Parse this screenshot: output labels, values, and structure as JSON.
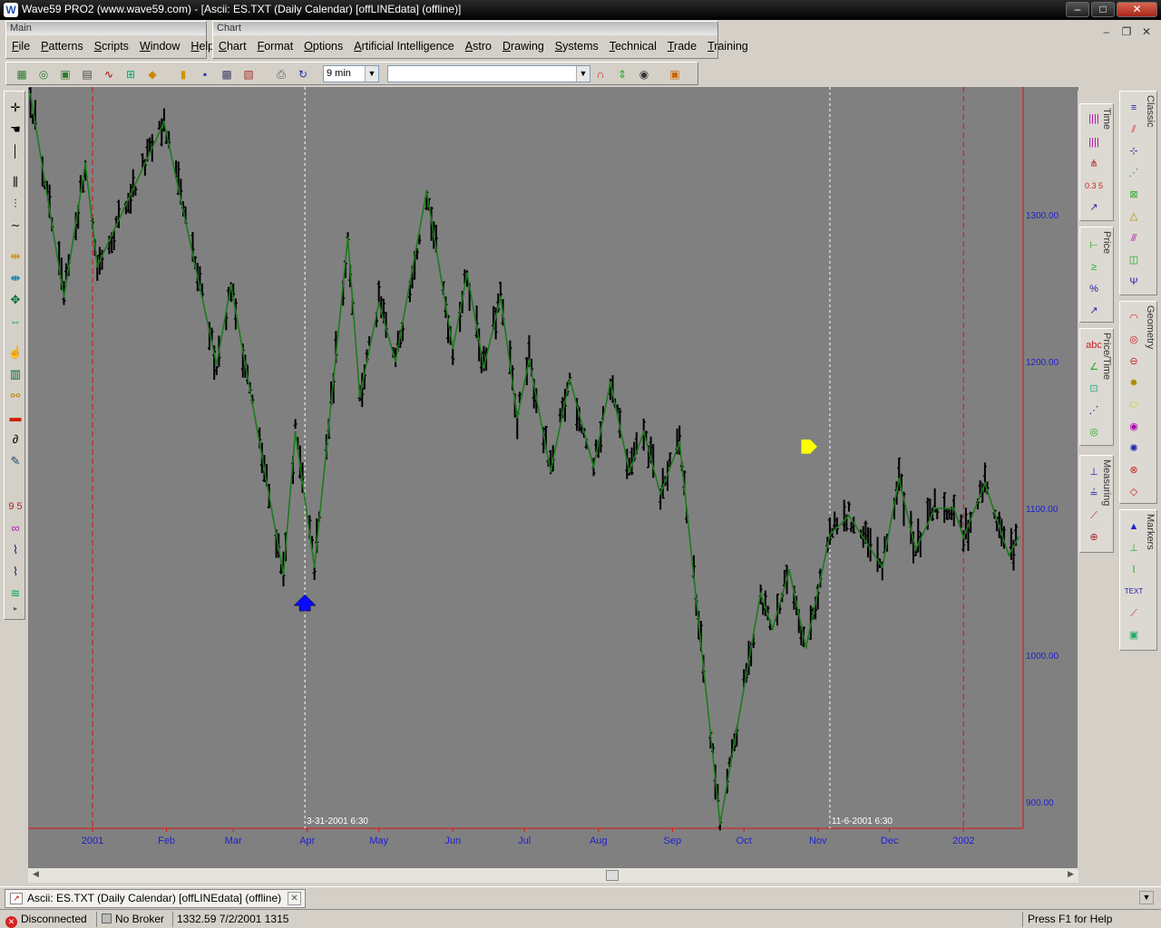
{
  "window": {
    "title": "Wave59 PRO2 (www.wave59.com) - [Ascii: ES.TXT (Daily Calendar) [offLINEdata] (offline)]",
    "minimize": "–",
    "maximize": "□",
    "close": "✕"
  },
  "mdi": {
    "minimize": "–",
    "restore": "❐",
    "close": "✕"
  },
  "bands": {
    "main": {
      "label": "Main",
      "menu": [
        "File",
        "Patterns",
        "Scripts",
        "Window",
        "Help"
      ]
    },
    "chart": {
      "label": "Chart",
      "menu": [
        "Chart",
        "Format",
        "Options",
        "Artificial Intelligence",
        "Astro",
        "Drawing",
        "Systems",
        "Technical",
        "Trade",
        "Training"
      ]
    }
  },
  "toolbar": {
    "interval_value": "9 min",
    "symbol_value": ""
  },
  "right_sections": {
    "time": "Time",
    "price": "Price",
    "price_time": "Price/Time",
    "measuring": "Measuring",
    "classic": "Classic",
    "geometry": "Geometry",
    "markers": "Markers",
    "fib_label": "0.3 5",
    "abc_label": "abc",
    "percent_label": "%",
    "text_label": "TEXT"
  },
  "left_tool_labels": {
    "ninefive": "9 5"
  },
  "chart_data": {
    "type": "line",
    "x_tick_labels": [
      "2001",
      "Feb",
      "Mar",
      "Apr",
      "May",
      "Jun",
      "Jul",
      "Aug",
      "Sep",
      "Oct",
      "Nov",
      "Dec",
      "2002"
    ],
    "x_tick_dates": [
      "2001-01-01",
      "2001-02-01",
      "2001-03-01",
      "2001-04-01",
      "2001-05-01",
      "2001-06-01",
      "2001-07-01",
      "2001-08-01",
      "2001-09-01",
      "2001-10-01",
      "2001-11-01",
      "2001-12-01",
      "2002-01-01"
    ],
    "x_range": [
      "2000-12-05",
      "2002-01-26"
    ],
    "y_tick_labels": [
      "900.00",
      "1000.00",
      "1100.00",
      "1200.00",
      "1300.00"
    ],
    "y_ticks": [
      900,
      1000,
      1100,
      1200,
      1300
    ],
    "ylim": [
      882,
      1387
    ],
    "grid": false,
    "cursor_lines": [
      {
        "date": "2001-03-31",
        "label": "3-31-2001 6:30"
      },
      {
        "date": "2001-11-06",
        "label": "11-6-2001 6:30"
      }
    ],
    "year_lines": [
      "2001-01-01",
      "2002-01-01"
    ],
    "series": [
      {
        "style": "zigzag",
        "color": "#1c7a1c",
        "points": [
          [
            "2000-12-06",
            1382
          ],
          [
            "2000-12-20",
            1244
          ],
          [
            "2000-12-29",
            1335
          ],
          [
            "2001-01-03",
            1265
          ],
          [
            "2001-01-31",
            1363
          ],
          [
            "2001-02-22",
            1198
          ],
          [
            "2001-02-28",
            1252
          ],
          [
            "2001-03-22",
            1055
          ],
          [
            "2001-03-27",
            1152
          ],
          [
            "2001-04-04",
            1060
          ],
          [
            "2001-04-18",
            1284
          ],
          [
            "2001-04-23",
            1176
          ],
          [
            "2001-05-01",
            1240
          ],
          [
            "2001-05-08",
            1200
          ],
          [
            "2001-05-21",
            1316
          ],
          [
            "2001-06-01",
            1209
          ],
          [
            "2001-06-07",
            1260
          ],
          [
            "2001-06-14",
            1196
          ],
          [
            "2001-06-21",
            1244
          ],
          [
            "2001-06-28",
            1162
          ],
          [
            "2001-07-03",
            1201
          ],
          [
            "2001-07-12",
            1125
          ],
          [
            "2001-07-20",
            1188
          ],
          [
            "2001-07-30",
            1128
          ],
          [
            "2001-08-06",
            1186
          ],
          [
            "2001-08-14",
            1125
          ],
          [
            "2001-08-20",
            1152
          ],
          [
            "2001-08-27",
            1110
          ],
          [
            "2001-09-04",
            1145
          ],
          [
            "2001-09-21",
            885
          ],
          [
            "2001-10-08",
            1042
          ],
          [
            "2001-10-13",
            1018
          ],
          [
            "2001-10-20",
            1058
          ],
          [
            "2001-10-27",
            1005
          ],
          [
            "2001-11-06",
            1082
          ],
          [
            "2001-11-14",
            1095
          ],
          [
            "2001-11-28",
            1060
          ],
          [
            "2001-12-05",
            1120
          ],
          [
            "2001-12-12",
            1072
          ],
          [
            "2001-12-20",
            1100
          ],
          [
            "2001-12-28",
            1100
          ],
          [
            "2002-01-01",
            1080
          ],
          [
            "2002-01-10",
            1117
          ],
          [
            "2002-01-20",
            1068
          ],
          [
            "2002-01-24",
            1080
          ]
        ]
      }
    ],
    "markers": [
      {
        "date": "2001-03-31",
        "value": 1035,
        "shape": "up-arrow",
        "color": "#0a0aff"
      },
      {
        "date": "2001-10-28",
        "value": 1142,
        "shape": "right-arrow",
        "color": "#ffff00"
      }
    ]
  },
  "tab": {
    "label": "Ascii: ES.TXT (Daily Calendar) [offLINEdata] (offline)",
    "close": "✕"
  },
  "status": {
    "connection": "Disconnected",
    "broker": "No Broker",
    "price_readout": "1332.59  7/2/2001  1315",
    "help": "Press F1 for Help"
  }
}
